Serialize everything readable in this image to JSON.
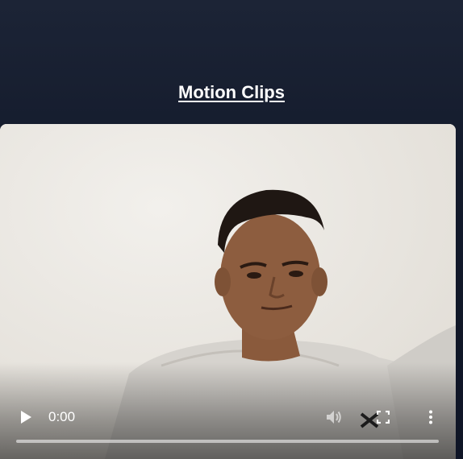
{
  "page": {
    "title": "Motion Clips"
  },
  "video": {
    "time": "0:00",
    "progress": 0,
    "play_icon": "play-icon",
    "mute_icon": "volume-icon",
    "fullscreen_icon": "fullscreen-icon",
    "more_icon": "more-vertical-icon"
  },
  "colors": {
    "background_top": "#1c2436",
    "background_bottom": "#0f1526",
    "title_text": "#ffffff"
  }
}
